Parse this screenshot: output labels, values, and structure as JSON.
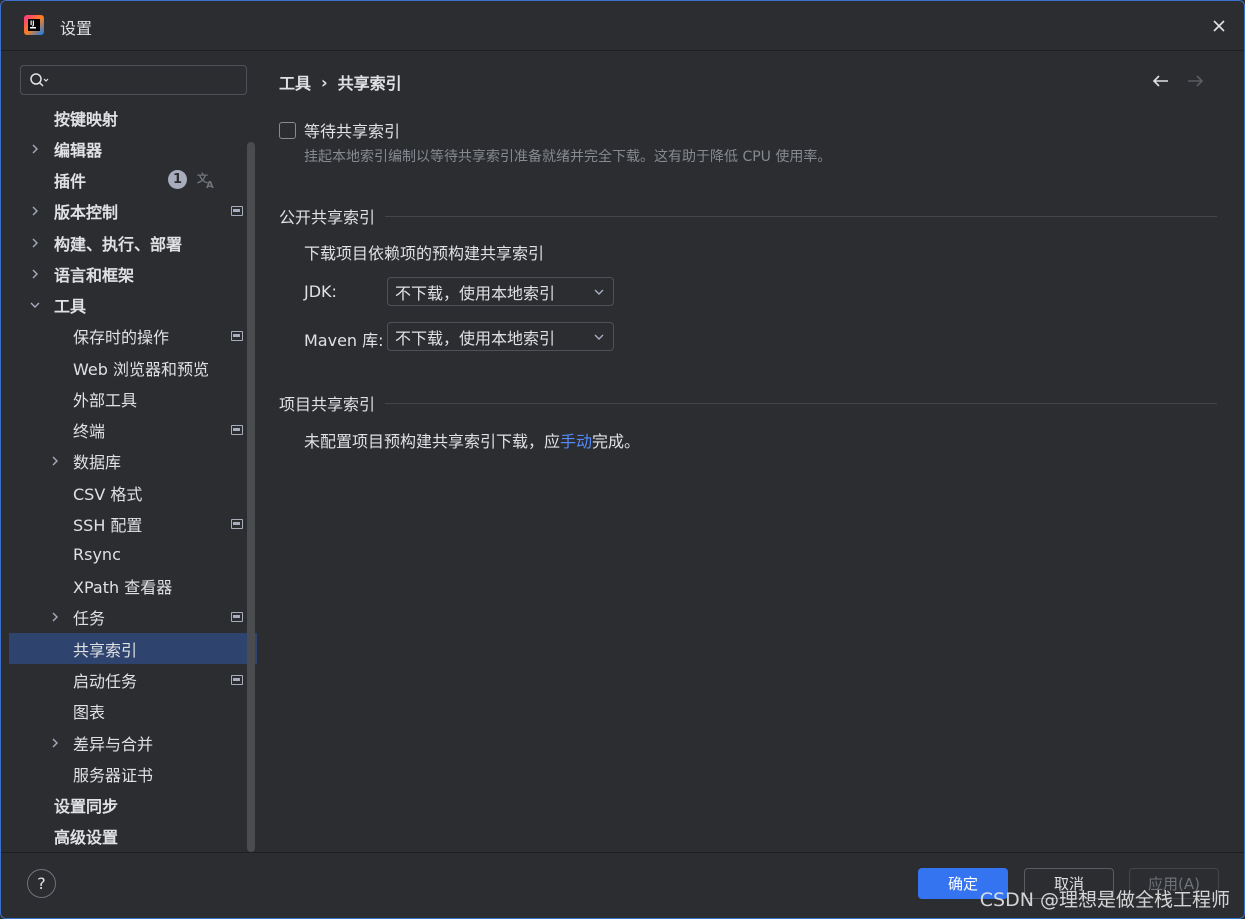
{
  "window": {
    "title": "设置"
  },
  "search": {
    "placeholder": ""
  },
  "sidebar": {
    "items": [
      {
        "label": "按键映射"
      },
      {
        "label": "编辑器"
      },
      {
        "label": "插件",
        "count": "1"
      },
      {
        "label": "版本控制"
      },
      {
        "label": "构建、执行、部署"
      },
      {
        "label": "语言和框架"
      },
      {
        "label": "工具"
      },
      {
        "label": "保存时的操作"
      },
      {
        "label": "Web 浏览器和预览"
      },
      {
        "label": "外部工具"
      },
      {
        "label": "终端"
      },
      {
        "label": "数据库"
      },
      {
        "label": "CSV 格式"
      },
      {
        "label": "SSH 配置"
      },
      {
        "label": "Rsync"
      },
      {
        "label": "XPath 查看器"
      },
      {
        "label": "任务"
      },
      {
        "label": "共享索引"
      },
      {
        "label": "启动任务"
      },
      {
        "label": "图表"
      },
      {
        "label": "差异与合并"
      },
      {
        "label": "服务器证书"
      },
      {
        "label": "设置同步"
      },
      {
        "label": "高级设置"
      }
    ]
  },
  "breadcrumb": {
    "parent": "工具",
    "separator": "›",
    "current": "共享索引"
  },
  "wait_option": {
    "label": "等待共享索引",
    "hint": "挂起本地索引编制以等待共享索引准备就绪并完全下载。这有助于降低 CPU 使用率。"
  },
  "public_section": {
    "title": "公开共享索引",
    "description": "下载项目依赖项的预构建共享索引",
    "jdk_label": "JDK:",
    "jdk_value": "不下载，使用本地索引",
    "maven_label": "Maven 库:",
    "maven_value": "不下载，使用本地索引"
  },
  "project_section": {
    "title": "项目共享索引",
    "text_before": "未配置项目预构建共享索引下载，应",
    "link": "手动",
    "text_after": "完成。"
  },
  "footer": {
    "help": "?",
    "ok": "确定",
    "cancel": "取消",
    "apply": "应用(A)"
  },
  "watermark": "CSDN @理想是做全栈工程师",
  "colors": {
    "accent": "#3574f0",
    "selection": "#2e436e",
    "link": "#548af7",
    "background": "#2b2d30"
  }
}
